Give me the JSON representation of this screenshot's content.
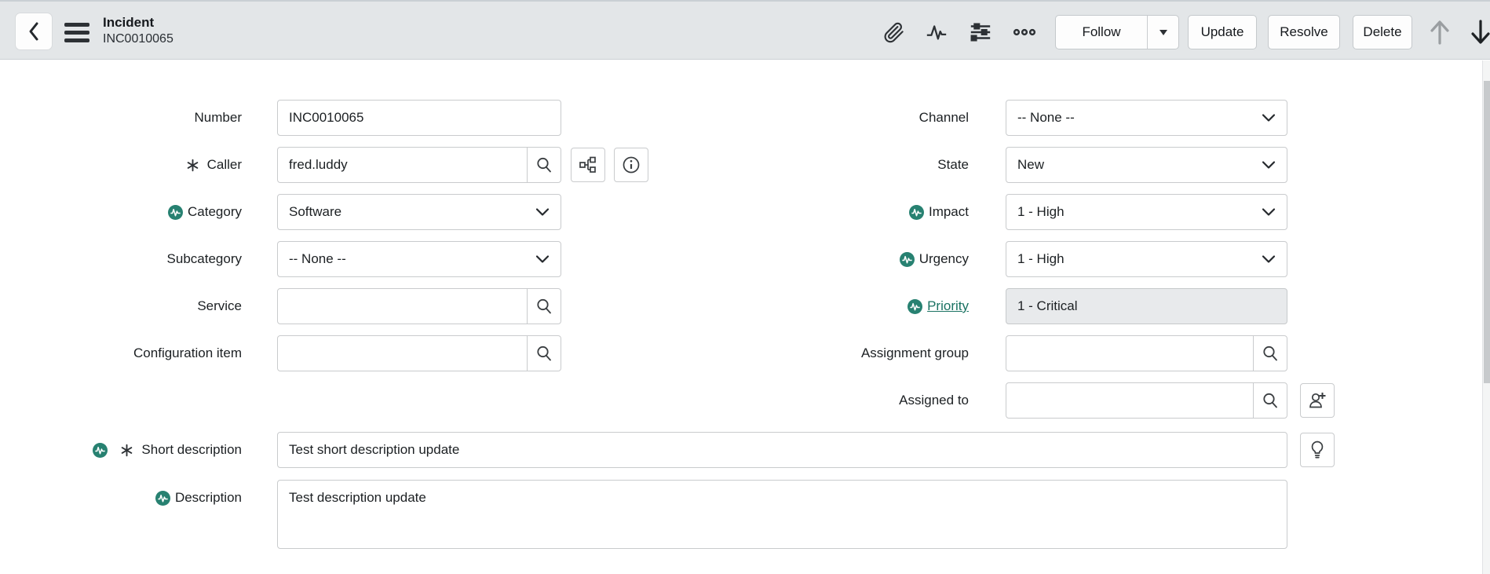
{
  "header": {
    "title": "Incident",
    "subtitle": "INC0010065",
    "buttons": {
      "follow": "Follow",
      "update": "Update",
      "resolve": "Resolve",
      "delete": "Delete"
    },
    "icons": {
      "back": "chevron-left",
      "menu": "hamburger",
      "attachment": "paperclip",
      "activity": "pulse-line",
      "personalize": "sliders",
      "more": "three-dots",
      "previous_record": "arrow-up",
      "next_record": "arrow-down"
    }
  },
  "colors": {
    "header_bg": "#e3e6e8",
    "teal_indicator": "#278171",
    "priority_link": "#1a7262",
    "readonly_bg": "#e8eaec"
  },
  "fields": {
    "number": {
      "label": "Number",
      "value": "INC0010065"
    },
    "caller": {
      "label": "Caller",
      "value": "fred.luddy",
      "required": true
    },
    "category": {
      "label": "Category",
      "value": "Software"
    },
    "subcategory": {
      "label": "Subcategory",
      "value": "-- None --"
    },
    "service": {
      "label": "Service",
      "value": ""
    },
    "configuration_item": {
      "label": "Configuration item",
      "value": ""
    },
    "channel": {
      "label": "Channel",
      "value": "-- None --"
    },
    "state": {
      "label": "State",
      "value": "New"
    },
    "impact": {
      "label": "Impact",
      "value": "1 - High"
    },
    "urgency": {
      "label": "Urgency",
      "value": "1 - High"
    },
    "priority": {
      "label": "Priority",
      "value": "1 - Critical",
      "readonly": true
    },
    "assignment_group": {
      "label": "Assignment group",
      "value": ""
    },
    "assigned_to": {
      "label": "Assigned to",
      "value": ""
    },
    "short_description": {
      "label": "Short description",
      "value": "Test short description update",
      "required": true
    },
    "description": {
      "label": "Description",
      "value": "Test description update"
    }
  }
}
